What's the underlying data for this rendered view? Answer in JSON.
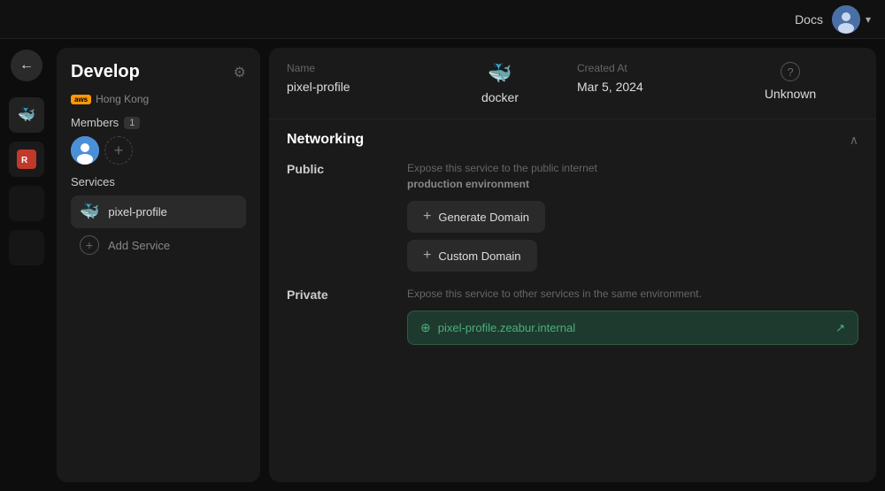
{
  "topbar": {
    "docs_label": "Docs",
    "chevron": "▾"
  },
  "icon_rail": {
    "back_label": "←",
    "docker_icon": "🐳",
    "redis_label": "R"
  },
  "sidebar": {
    "project_title": "Develop",
    "region_badge": "aws",
    "region_name": "Hong Kong",
    "members_label": "Members",
    "members_count": "1",
    "services_label": "Services",
    "active_service": "pixel-profile",
    "add_service_label": "Add Service"
  },
  "service_header": {
    "name_label": "Name",
    "name_value": "pixel-profile",
    "type_label": "docker",
    "created_label": "Created At",
    "created_value": "Mar 5, 2024",
    "status_label": "Unknown"
  },
  "networking": {
    "section_title": "Networking",
    "public_label": "Public",
    "public_desc": "Expose this service to the public internet",
    "public_env": "production environment",
    "generate_domain_btn": "Generate Domain",
    "custom_domain_btn": "Custom Domain",
    "private_label": "Private",
    "private_desc": "Expose this service to other services in the same environment.",
    "private_domain": "pixel-profile.zeabur.internal"
  }
}
